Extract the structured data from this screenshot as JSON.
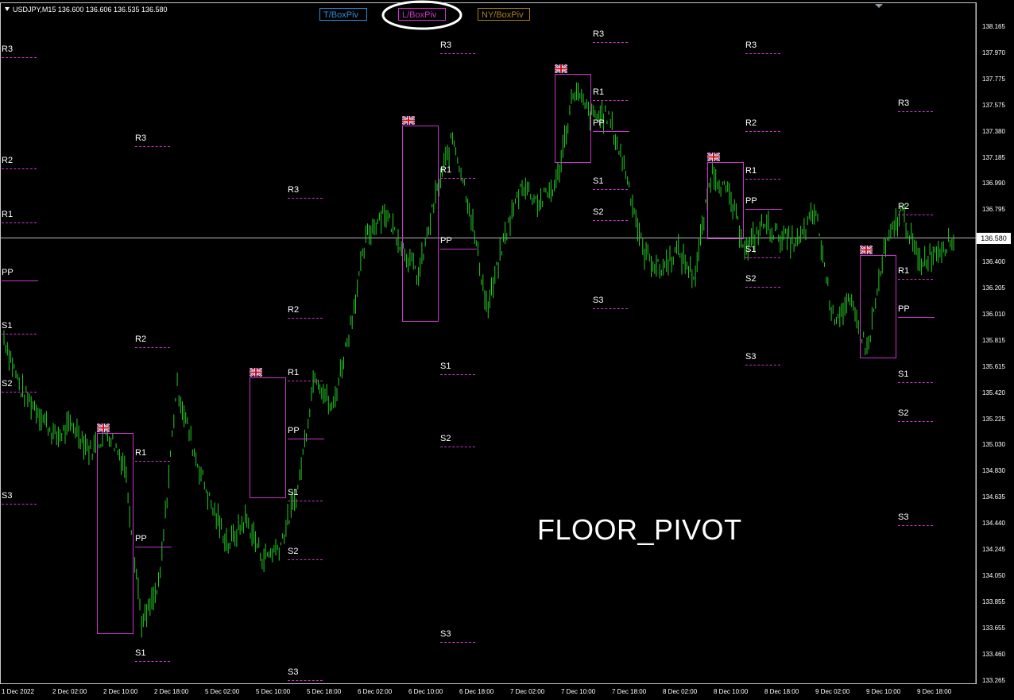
{
  "symbol": "USDJPY,M15",
  "ohlc": "136.600 136.606 136.535 136.580",
  "buttons": [
    {
      "label": "T/BoxPiv",
      "color": "#2a8fd8"
    },
    {
      "label": "L/BoxPiv",
      "color": "#cc33cc"
    },
    {
      "label": "NY/BoxPiv",
      "color": "#a8801c"
    }
  ],
  "selected_button": "L/BoxPiv",
  "watermark": "FLOOR_PIVOT",
  "current_price": "136.580",
  "colors": {
    "candles": "#22cc22",
    "pivot": "#cc33cc",
    "highlight": "#ffffff"
  },
  "price_axis": [
    "138.165",
    "137.970",
    "137.775",
    "137.575",
    "137.380",
    "137.185",
    "136.990",
    "136.795",
    "136.580",
    "136.400",
    "136.205",
    "136.010",
    "135.815",
    "135.615",
    "135.420",
    "135.225",
    "135.030",
    "134.830",
    "134.635",
    "134.440",
    "134.245",
    "134.050",
    "133.855",
    "133.655",
    "133.460",
    "133.265"
  ],
  "time_axis": [
    "1 Dec 2022",
    "2 Dec 02:00",
    "2 Dec 10:00",
    "2 Dec 18:00",
    "5 Dec 02:00",
    "5 Dec 10:00",
    "5 Dec 18:00",
    "6 Dec 02:00",
    "6 Dec 10:00",
    "6 Dec 18:00",
    "7 Dec 02:00",
    "7 Dec 10:00",
    "7 Dec 18:00",
    "8 Dec 02:00",
    "8 Dec 10:00",
    "8 Dec 18:00",
    "9 Dec 02:00",
    "9 Dec 10:00",
    "9 Dec 18:00"
  ],
  "pivot_labels": [
    "R3",
    "R2",
    "R1",
    "PP",
    "S1",
    "S2",
    "S3"
  ],
  "price_path": [
    135.85,
    135.45,
    135.3,
    135.1,
    135.2,
    135.0,
    135.15,
    134.9,
    133.7,
    134.0,
    135.5,
    135.0,
    134.6,
    134.3,
    134.5,
    134.2,
    134.3,
    134.7,
    135.6,
    135.3,
    135.9,
    136.6,
    136.8,
    136.55,
    136.3,
    136.9,
    137.35,
    136.8,
    136.05,
    136.6,
    137.0,
    136.85,
    137.0,
    137.7,
    137.5,
    137.5,
    137.1,
    136.5,
    136.35,
    136.5,
    136.3,
    137.1,
    136.9,
    136.5,
    136.7,
    136.6,
    136.55,
    136.8,
    136.0,
    136.1,
    135.75,
    136.5,
    136.8,
    136.4,
    136.5,
    136.58
  ]
}
